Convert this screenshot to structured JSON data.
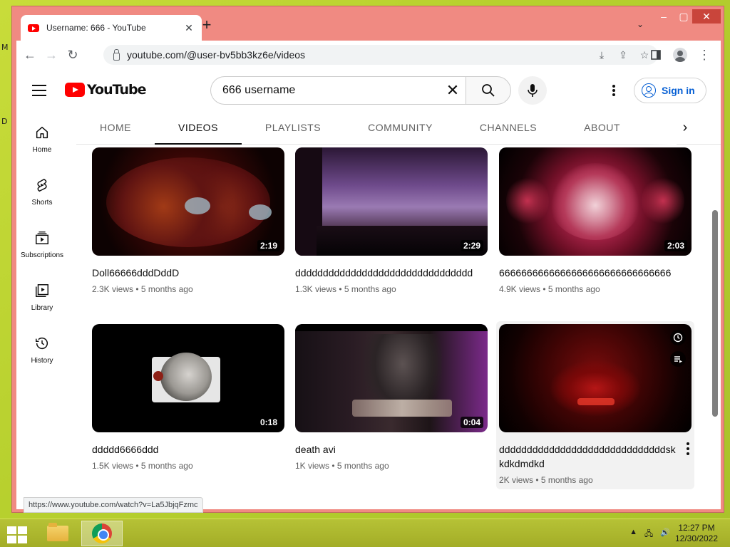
{
  "desktop": {
    "left_glyph_top": "M",
    "left_glyph_mid": "D"
  },
  "browser": {
    "tab_title": "Username: 666 - YouTube",
    "url": "youtube.com/@user-bv5bb3kz6e/videos",
    "status_url": "https://www.youtube.com/watch?v=La5JbjqFzmc"
  },
  "youtube": {
    "logo_text": "YouTube",
    "search_query": "666 username",
    "signin_label": "Sign in",
    "sidebar": [
      {
        "label": "Home",
        "icon": "home-icon"
      },
      {
        "label": "Shorts",
        "icon": "shorts-icon"
      },
      {
        "label": "Subscriptions",
        "icon": "subscriptions-icon"
      },
      {
        "label": "Library",
        "icon": "library-icon"
      },
      {
        "label": "History",
        "icon": "history-icon"
      }
    ],
    "channel_tabs": [
      "HOME",
      "VIDEOS",
      "PLAYLISTS",
      "COMMUNITY",
      "CHANNELS",
      "ABOUT"
    ],
    "active_tab": "VIDEOS",
    "videos": [
      {
        "title": "Doll66666dddDddD",
        "duration": "2:19",
        "views": "2.3K views",
        "age": "5 months ago"
      },
      {
        "title": "dddddddddddddddddddddddddddddddd",
        "duration": "2:29",
        "views": "1.3K views",
        "age": "5 months ago"
      },
      {
        "title": "6666666666666666666666666666666",
        "duration": "2:03",
        "views": "4.9K views",
        "age": "5 months ago"
      },
      {
        "title": "ddddd6666ddd",
        "duration": "0:18",
        "views": "1.5K views",
        "age": "5 months ago"
      },
      {
        "title": "death avi",
        "duration": "0:04",
        "views": "1K views",
        "age": "5 months ago"
      },
      {
        "title": "ddddddddddddddddddddddddddddddskkdkdmdkd",
        "duration": "",
        "views": "2K views",
        "age": "5 months ago"
      }
    ]
  },
  "taskbar": {
    "time": "12:27 PM",
    "date": "12/30/2022"
  },
  "colors": {
    "accent_blue": "#065fd4",
    "youtube_red": "#ff0000",
    "window_frame": "#f08a82",
    "desktop": "#b7d02e"
  }
}
